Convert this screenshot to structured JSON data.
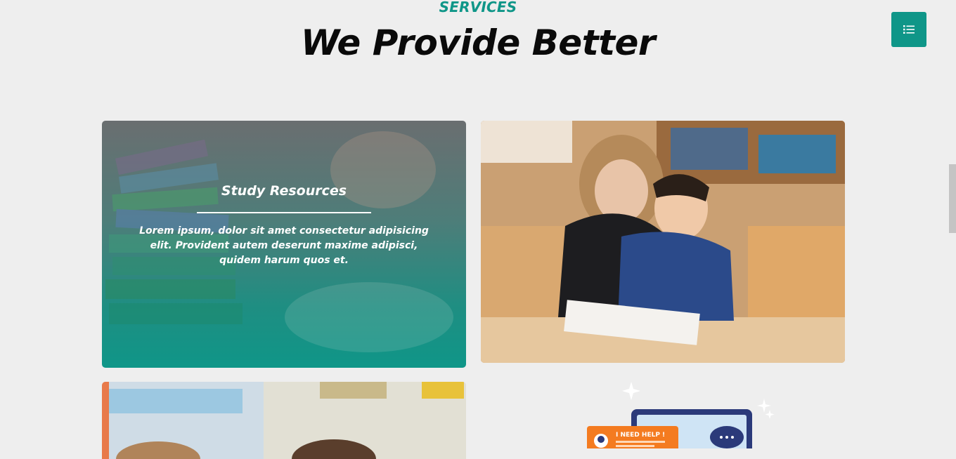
{
  "header": {
    "eyebrow": "SERVICES",
    "title": "We Provide Better"
  },
  "menu_button": {
    "icon": "list-icon"
  },
  "cards": [
    {
      "title": "Study Resources",
      "text": "Lorem ipsum, dolor sit amet consectetur adipisicing elit. Provident autem deserunt maxime adipisci, quidem harum quos et.",
      "image": "stacked-books-photo"
    },
    {
      "image": "teacher-helping-student-photo"
    },
    {
      "image": "classroom-students-photo"
    },
    {
      "image": "online-help-illustration",
      "badge": "I NEED HELP !"
    }
  ],
  "colors": {
    "accent": "#0f9688",
    "background": "#eeeeee",
    "help_badge": "#f47b20",
    "laptop": "#2b3a7a"
  }
}
